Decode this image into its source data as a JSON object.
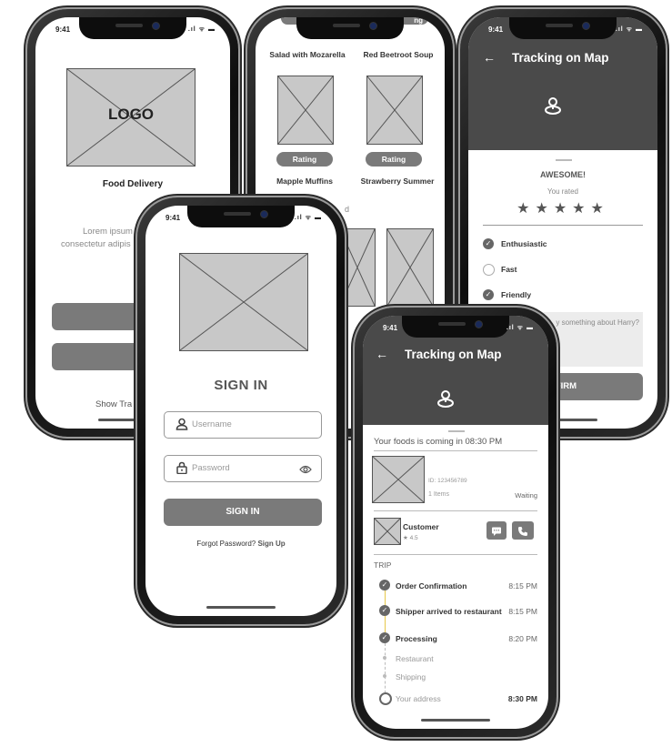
{
  "status_time": "9:41",
  "status_icons": ".ıl ᯤ ▬",
  "welcome": {
    "logo_text": "LOGO",
    "app_name": "Food Delivery",
    "body_line1": "Lorem ipsum d",
    "body_line2": "consectetur adipis",
    "link_text": "Show Tra"
  },
  "menu": {
    "rating_top_left": "R",
    "rating_top_right": "ng",
    "items": [
      {
        "name": "Salad with Mozarella"
      },
      {
        "name": "Red Beetroot Soup"
      },
      {
        "name": "Mapple Muffins"
      },
      {
        "name": "Strawberry Summer"
      }
    ],
    "rating_label": "Rating",
    "partial_text": "d"
  },
  "rating_screen": {
    "title": "Tracking on Map",
    "awesome": "AWESOME!",
    "you_rated": "You rated",
    "stars": 5,
    "options": [
      {
        "label": "Enthusiastic",
        "checked": true
      },
      {
        "label": "Fast",
        "checked": false
      },
      {
        "label": "Friendly",
        "checked": true
      }
    ],
    "comment_placeholder": "y something about Harry?",
    "confirm_label": "NFIRM"
  },
  "signin": {
    "title": "SIGN IN",
    "username_placeholder": "Username",
    "password_placeholder": "Password",
    "button_label": "SIGN IN",
    "forgot_text": "Forgot Password?",
    "signup_text": "Sign Up"
  },
  "tracking": {
    "title": "Tracking on Map",
    "eta_text": "Your foods is coming in 08:30 PM",
    "order_id": "ID: 123456789",
    "items_count": "1 Items",
    "order_status": "Waiting",
    "customer_name": "Customer",
    "customer_rating": "★ 4.5",
    "trip_label": "TRIP",
    "steps": [
      {
        "label": "Order Confirmation",
        "time": "8:15 PM",
        "done": true
      },
      {
        "label": "Shipper arrived to restaurant",
        "time": "8:15 PM",
        "done": true
      },
      {
        "label": "Processing",
        "time": "8:20 PM",
        "done": true
      },
      {
        "label": "Restaurant",
        "time": "",
        "done": false
      },
      {
        "label": "Shipping",
        "time": "",
        "done": false
      },
      {
        "label": "Your address",
        "time": "8:30 PM",
        "done": false
      }
    ]
  },
  "colors": {
    "header_gray": "#4a4a4a",
    "button_gray": "#7a7a7a",
    "placeholder_gray": "#c8c8c8",
    "timeline_accent": "#e6c84a"
  }
}
